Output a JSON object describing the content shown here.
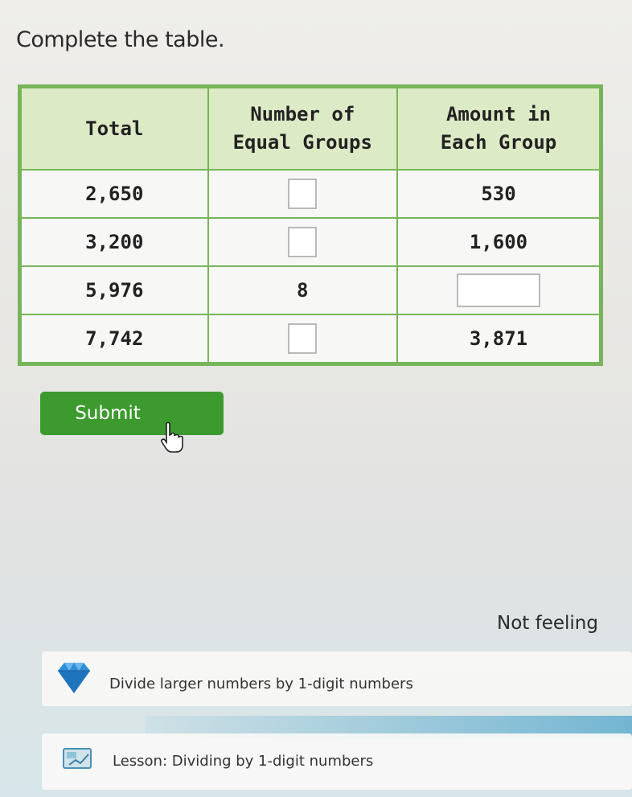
{
  "prompt": "Complete the table.",
  "table": {
    "headers": [
      "Total",
      "Number of Equal Groups",
      "Amount in Each Group"
    ],
    "header_lines": {
      "col1": [
        "Total"
      ],
      "col2": [
        "Number of",
        "Equal Groups"
      ],
      "col3": [
        "Amount in",
        "Each Group"
      ]
    },
    "rows": [
      {
        "total": "2,650",
        "groups": "",
        "amount": "530"
      },
      {
        "total": "3,200",
        "groups": "",
        "amount": "1,600"
      },
      {
        "total": "5,976",
        "groups": "8",
        "amount": ""
      },
      {
        "total": "7,742",
        "groups": "",
        "amount": "3,871"
      }
    ]
  },
  "submit_label": "Submit",
  "not_feeling_text": "Not feeling",
  "skill": {
    "label": "Divide larger numbers by 1-digit numbers",
    "icon": "diamond-icon"
  },
  "lesson": {
    "label": "Lesson: Dividing by 1-digit numbers",
    "icon": "lesson-icon"
  },
  "colors": {
    "table_border": "#77b55a",
    "header_bg": "#dcebc5",
    "submit_bg": "#3c9a2e",
    "diamond": "#2f8fd6"
  }
}
